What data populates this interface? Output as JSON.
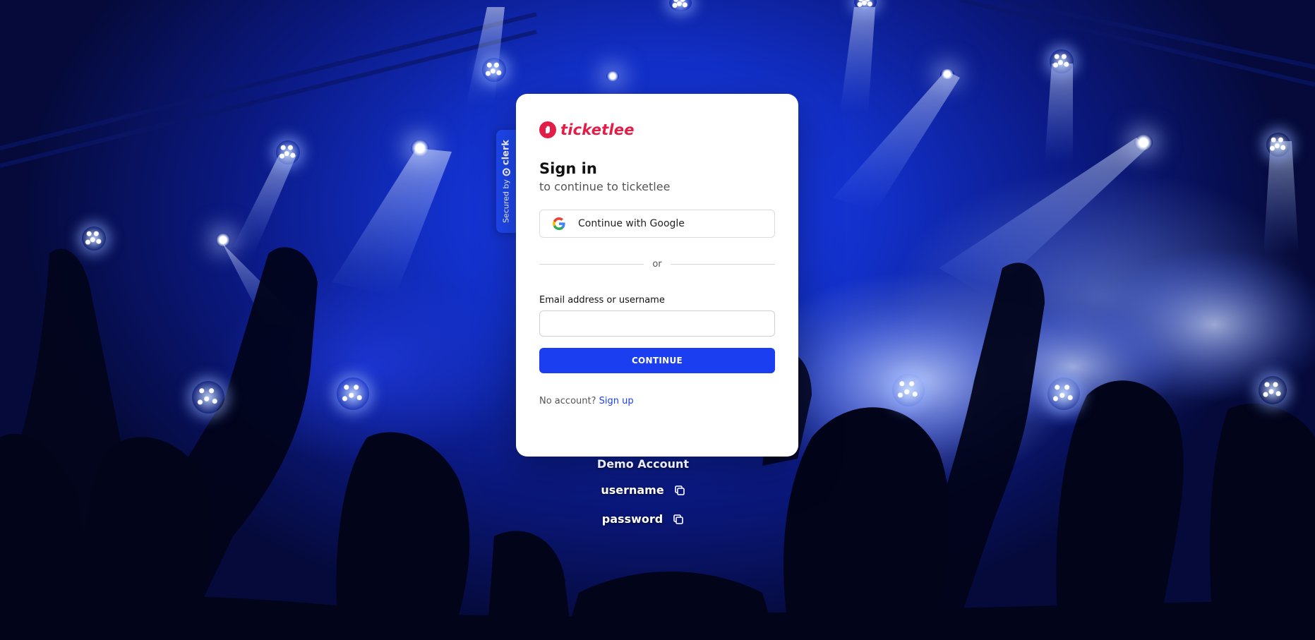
{
  "background": {
    "description_icon": "concert-stage-photo"
  },
  "clerk_badge": {
    "secured_by": "Secured by",
    "brand": "clerk"
  },
  "card": {
    "logo": {
      "text": "ticketlee",
      "color": "#e11d48",
      "icon": "ticket-hand-icon"
    },
    "title": "Sign in",
    "subtitle": "to continue to ticketlee",
    "google_button_label": "Continue with Google",
    "divider_text": "or",
    "email_label": "Email address or username",
    "email_value": "",
    "continue_label": "CONTINUE",
    "no_account_text": "No account?",
    "sign_up_link": "Sign up",
    "accent_color": "#1b3ff0"
  },
  "demo": {
    "title": "Demo Account",
    "username_label": "username",
    "password_label": "password"
  }
}
